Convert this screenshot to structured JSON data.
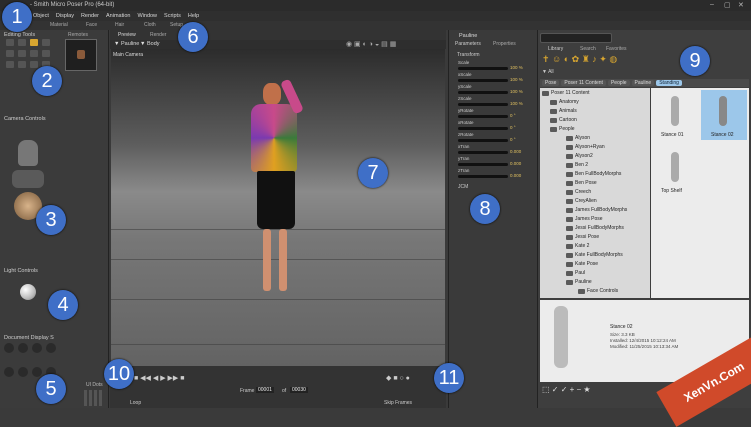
{
  "app": {
    "title": "- Smith Micro Poser Pro  (64-bit)"
  },
  "menu": [
    "Object",
    "Display",
    "Render",
    "Animation",
    "Window",
    "Scripts",
    "Help"
  ],
  "top_tabs": [
    "Material",
    "Face",
    "Hair",
    "Cloth",
    "Setup"
  ],
  "left": {
    "editing_tools_label": "Editing Tools",
    "thumb_tab_label": "Remotes",
    "camera_controls_label": "Camera Controls",
    "light_controls_label": "Light Controls",
    "document_display_label": "Document Display S",
    "ui_dots_label": "UI Dots"
  },
  "viewport": {
    "tabs": [
      "Preview",
      "Render"
    ],
    "figure_label": "Pauline",
    "body_label": "Body",
    "camera_label": "Main Camera"
  },
  "playback": {
    "frame_label": "Frame",
    "frame_value": "00001",
    "of_label": "of",
    "total_frames": "00030",
    "loop_label": "Loop",
    "skip_frames_label": "Skip Frames"
  },
  "parameters": {
    "figure": "Pauline",
    "tabs": [
      "Parameters",
      "Properties"
    ],
    "group": "Transform",
    "rows": [
      {
        "label": "Scale",
        "value": "100 %"
      },
      {
        "label": "xScale",
        "value": "100 %"
      },
      {
        "label": "yScale",
        "value": "100 %"
      },
      {
        "label": "zScale",
        "value": "100 %"
      },
      {
        "label": "yRotate",
        "value": "0 °"
      },
      {
        "label": "xRotate",
        "value": "0 °"
      },
      {
        "label": "zRotate",
        "value": "0 °"
      },
      {
        "label": "xTran",
        "value": "0.000"
      },
      {
        "label": "yTran",
        "value": "0.000"
      },
      {
        "label": "zTran",
        "value": "0.000"
      }
    ],
    "footer_label": "JCM"
  },
  "library": {
    "tabs": [
      "Library",
      "Search",
      "Favorites"
    ],
    "all_label": "All",
    "breadcrumbs": [
      "Pose",
      "Poser 11 Content",
      "People",
      "Pauline",
      "Standing"
    ],
    "tree": [
      "Poser 11 Content",
      "Anatomy",
      "Animals",
      "Cartoon",
      "People",
      "Alyson",
      "Alyson+Ryan",
      "Alyson2",
      "Ben 2",
      "Ben FullBodyMorphs",
      "Ben Pose",
      "Creech",
      "CreyAlien",
      "James FullBodyMorphs",
      "James Pose",
      "Jessi FullBodyMorphs",
      "Jessi Pose",
      "Kate 2",
      "Kate FullBodyMorphs",
      "Kate Pose",
      "Paul",
      "Pauline",
      "Face Controls"
    ],
    "thumbs": [
      "Stance 01",
      "Stance 02",
      "Top Shelf"
    ],
    "preview": {
      "name": "Stance 02",
      "size": "Size: 3.3 KB",
      "installed": "Installed: 12/4/2015 10:12:24 AM",
      "modified": "Modified: 11/25/2015 10:13:34 AM"
    }
  },
  "callouts": [
    "1",
    "2",
    "3",
    "4",
    "5",
    "6",
    "7",
    "8",
    "9",
    "10",
    "11"
  ],
  "watermark": "XenVn.Com",
  "colors": {
    "callout_bg": "#3f6fc7",
    "active_tool": "#d8a630",
    "crumb_active": "#9cc7ea",
    "watermark": "#d04a2a"
  }
}
